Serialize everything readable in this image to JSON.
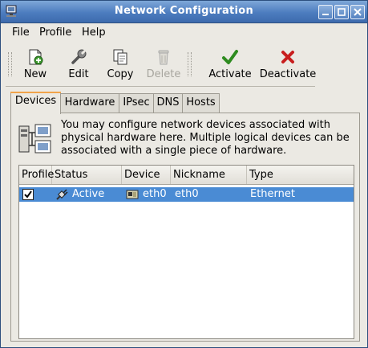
{
  "window": {
    "title": "Network Configuration"
  },
  "menu": [
    "File",
    "Profile",
    "Help"
  ],
  "toolbar": {
    "new": "New",
    "edit": "Edit",
    "copy": "Copy",
    "delete": "Delete",
    "activate": "Activate",
    "deactivate": "Deactivate"
  },
  "tabs": [
    "Devices",
    "Hardware",
    "IPsec",
    "DNS",
    "Hosts"
  ],
  "devices": {
    "description": "You may configure network devices associated with physical hardware here.  Multiple logical devices can be associated with a single piece of hardware.",
    "columns": [
      "Profile",
      "Status",
      "Device",
      "Nickname",
      "Type"
    ],
    "rows": [
      {
        "profile_checked": true,
        "status": "Active",
        "device": "eth0",
        "nickname": "eth0",
        "type": "Ethernet"
      }
    ]
  },
  "colors": {
    "title_bar": "#4c7cbf",
    "selection": "#4a8bd4",
    "active_tab_accent": "#f0a34a"
  }
}
